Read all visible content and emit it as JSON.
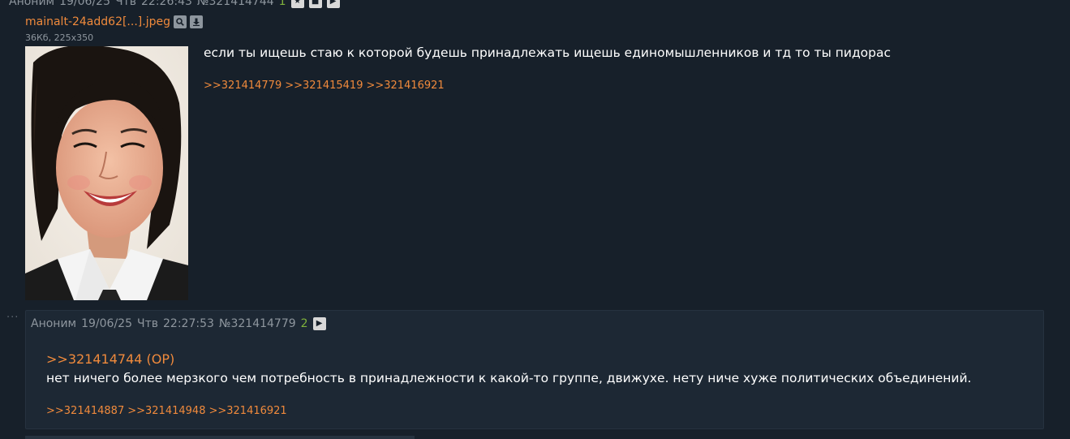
{
  "post": {
    "header": {
      "author": "Аноним",
      "date": "19/06/25",
      "weekday": "Чтв",
      "time": "22:26:43",
      "number": "№321414744",
      "reply_count": "1"
    },
    "file": {
      "name": "mainalt-24add62[...].jpeg",
      "meta": "36Кб, 225x350"
    },
    "message": "если ты ищешь стаю к которой будешь принадлежать ищешь единомышленников и тд то ты пидорас",
    "replies": [
      ">>321414779",
      ">>321415419",
      ">>321416921"
    ]
  },
  "reply": {
    "header": {
      "author": "Аноним",
      "date": "19/06/25",
      "weekday": "Чтв",
      "time": "22:27:53",
      "number": "№321414779",
      "reply_count": "2"
    },
    "quote": ">>321414744 (OP)",
    "message": "нет ничего более мерзкого чем потребность в принадлежности к какой-то группе, движухе. нету ниче хуже политических объединений.",
    "replies": [
      ">>321414887",
      ">>321414948",
      ">>321416921"
    ]
  },
  "icons": {
    "star": "star-icon",
    "pin": "pin-icon",
    "play": "play-icon",
    "search": "search-icon",
    "download": "download-icon",
    "more": "more-dots-icon"
  },
  "colors": {
    "background": "#17202a",
    "reply_background": "#1d2834",
    "link": "#f08a3c",
    "meta": "#8e969e",
    "reply_count": "#7fb23c"
  }
}
